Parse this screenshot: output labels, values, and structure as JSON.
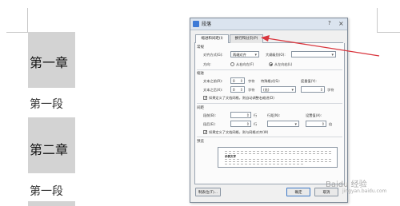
{
  "document": {
    "heading1": "第一章",
    "para1": "第一段",
    "heading2": "第二章",
    "para2": "第一段"
  },
  "dialog": {
    "title": "段落",
    "help_glyph": "?",
    "close_glyph": "×",
    "tabs": [
      "缩进和间距(I)",
      "换行和分页(P)"
    ],
    "general": {
      "section": "常规",
      "align_label": "对齐方式(G):",
      "align_value": "两端对齐",
      "outline_label": "大纲级别(O):",
      "outline_value": "",
      "direction_label": "方向:",
      "rtl_label": "从右向左(F)",
      "ltr_label": "从左向右(L)"
    },
    "indent": {
      "section": "缩进",
      "before_label": "文本之前(R):",
      "before_value": "0",
      "before_unit": "字符",
      "special_label": "特殊格式(S):",
      "measure_label": "度量值(Y):",
      "after_label": "文本之后(X):",
      "after_value": "0",
      "after_unit": "字符",
      "special_value": "(无)",
      "measure_unit": "字符",
      "grid_check": "如果定义了文档网格，则自动调整右缩进(D)"
    },
    "spacing": {
      "section": "间距",
      "before_label": "段前(B):",
      "before_unit": "行",
      "linespacing_label": "行距(N):",
      "setvalue_label": "设置值(A):",
      "after_label": "段后(E):",
      "after_unit": "行",
      "setvalue_unit": "倍",
      "grid_check": "如果定义了文档网格，则与网格对齐(W)"
    },
    "preview": {
      "section": "预览",
      "sample_text": "示例文字"
    },
    "buttons": {
      "tabs": "制表位(T)...",
      "ok": "确定",
      "cancel": "取消"
    }
  },
  "annotation": {
    "arrow_color": "#d9363e"
  },
  "watermark": {
    "text": "Baidu 经验",
    "sub": "jingyan.baidu.com"
  }
}
